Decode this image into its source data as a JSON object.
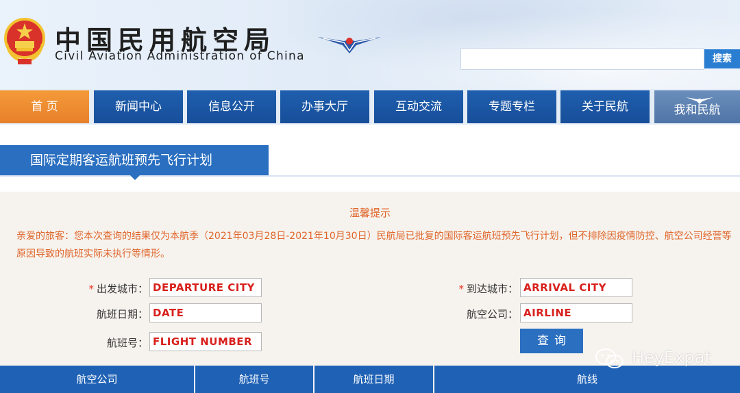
{
  "header": {
    "title_cn": "中国民用航空局",
    "title_en": "Civil Aviation Administration of China",
    "search_button": "搜索",
    "search_placeholder": ""
  },
  "nav": {
    "items": [
      {
        "label": "首 页",
        "active": true
      },
      {
        "label": "新闻中心"
      },
      {
        "label": "信息公开"
      },
      {
        "label": "办事大厅"
      },
      {
        "label": "互动交流"
      },
      {
        "label": "专题专栏"
      },
      {
        "label": "关于民航"
      },
      {
        "label": "我和民航"
      }
    ]
  },
  "section": {
    "title": "国际定期客运航班预先飞行计划"
  },
  "notice": {
    "title": "温馨提示",
    "text": "亲爱的旅客：您本次查询的结果仅为本航季（2021年03月28日-2021年10月30日）民航局已批复的国际客运航班预先飞行计划，但不排除因疫情防控、航空公司经营等原因导致的航班实际未执行等情形。"
  },
  "form": {
    "departure_label": "出发城市：",
    "departure_value": "DEPARTURE CITY",
    "arrival_label": "到达城市：",
    "arrival_value": "ARRIVAL CITY",
    "date_label": "航班日期：",
    "date_value": "DATE",
    "airline_label": "航空公司：",
    "airline_value": "AIRLINE",
    "flight_label": "航班号：",
    "flight_value": "FLIGHT NUMBER",
    "required_mark": "*",
    "query_button": "查询"
  },
  "table": {
    "columns": [
      "航空公司",
      "航班号",
      "航班日期",
      "航线"
    ]
  },
  "watermark": {
    "text": "HeyExpat"
  },
  "colors": {
    "nav_blue": "#1f5fae",
    "nav_active": "#f49a3a",
    "notice_orange": "#e0652a",
    "input_text_red": "#d8201c",
    "section_blue": "#2a6fc0"
  }
}
